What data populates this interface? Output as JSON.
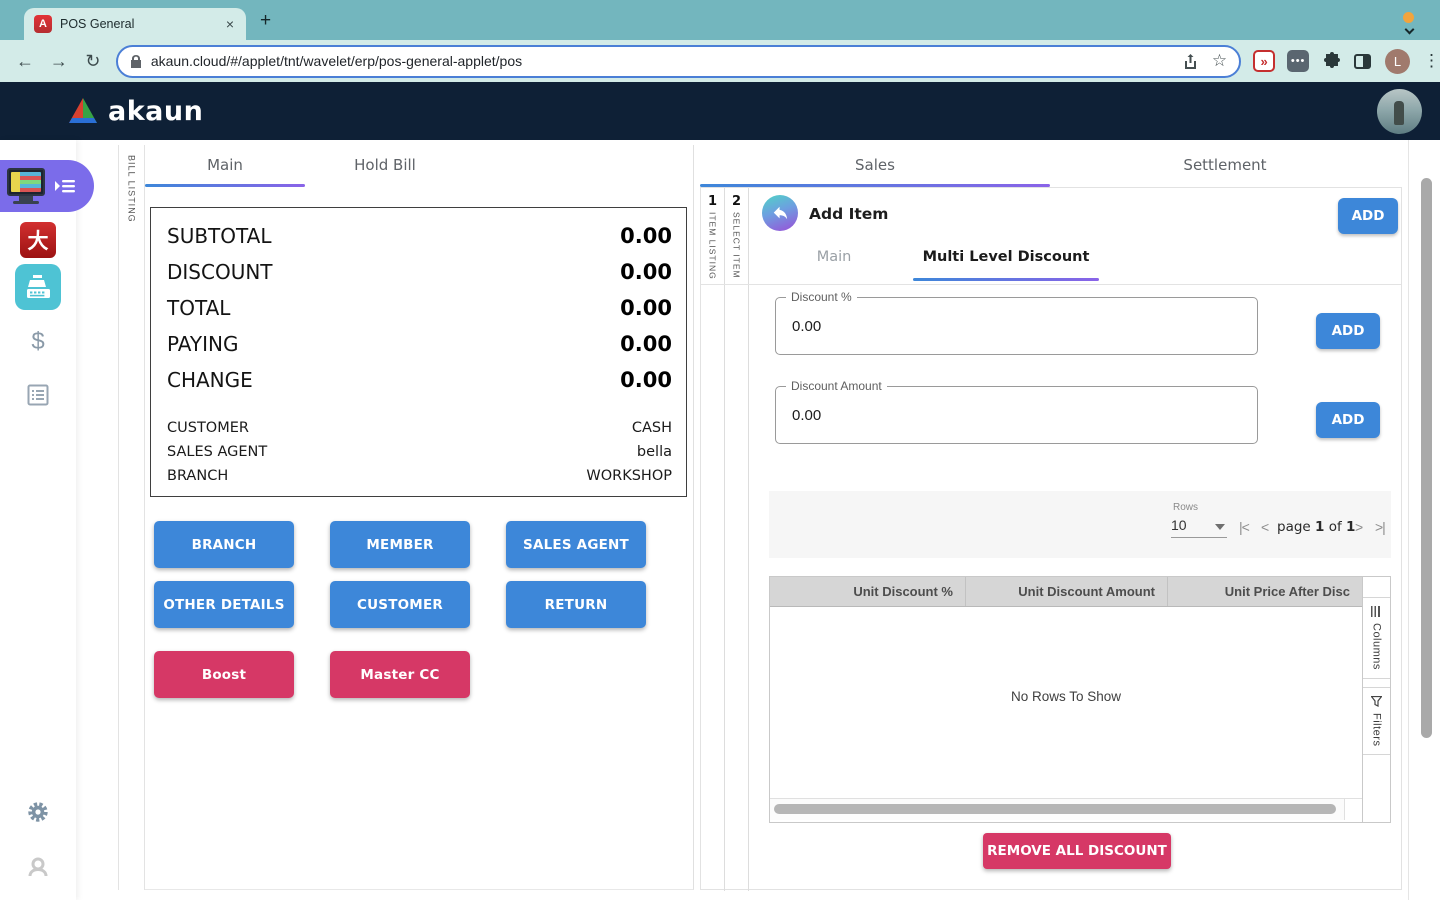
{
  "theme": {
    "navy": "#0e2036",
    "tabbar_teal": "#73b6be",
    "toolbar_mint": "#d3ebe8",
    "primary_blue": "#3d87d9",
    "accent_pink": "#d63866",
    "sidebar_purple": "#7b6cea",
    "sidebar_cyan": "#4ec3d4",
    "underline_gradient": [
      "#3d87d9",
      "#8a63e8"
    ]
  },
  "browser": {
    "tab_title": "POS General",
    "close_glyph": "×",
    "new_tab_glyph": "+",
    "back_glyph": "←",
    "forward_glyph": "→",
    "reload_glyph": "↻",
    "url": "akaun.cloud/#/applet/tnt/wavelet/erp/pos-general-applet/pos",
    "star_glyph": "☆",
    "ext_red_glyph": "»",
    "ext_dots_glyph": "•••",
    "profile_initial": "L",
    "menu_glyph": "⋮"
  },
  "navbar": {
    "brand": "akaun"
  },
  "sidebar": {
    "cny_char": "大",
    "dollar_glyph": "$"
  },
  "main_panel": {
    "rail_label": "BILL LISTING",
    "tabs": [
      {
        "label": "Main"
      },
      {
        "label": "Hold Bill"
      }
    ],
    "totals": [
      {
        "label": "SUBTOTAL",
        "value": "0.00"
      },
      {
        "label": "DISCOUNT",
        "value": "0.00"
      },
      {
        "label": "TOTAL",
        "value": "0.00"
      },
      {
        "label": "PAYING",
        "value": "0.00"
      },
      {
        "label": "CHANGE",
        "value": "0.00"
      }
    ],
    "info": [
      {
        "label": "CUSTOMER",
        "value": "CASH"
      },
      {
        "label": "SALES AGENT",
        "value": "bella"
      },
      {
        "label": "BRANCH",
        "value": "WORKSHOP"
      }
    ],
    "action_buttons": [
      "BRANCH",
      "MEMBER",
      "SALES AGENT",
      "OTHER DETAILS",
      "CUSTOMER",
      "RETURN"
    ],
    "special_buttons": [
      "Boost",
      "Master CC"
    ]
  },
  "right_panel": {
    "tabs": [
      {
        "label": "Sales"
      },
      {
        "label": "Settlement"
      }
    ],
    "rails": [
      {
        "num": "1",
        "label": "ITEM LISTING"
      },
      {
        "num": "2",
        "label": "SELECT ITEM"
      }
    ],
    "header": {
      "title": "Add Item",
      "add_label": "ADD"
    },
    "inner_tabs": [
      {
        "label": "Main"
      },
      {
        "label": "Multi Level Discount"
      }
    ],
    "fields": [
      {
        "label": "Discount %",
        "value": "0.00",
        "button": "ADD"
      },
      {
        "label": "Discount Amount",
        "value": "0.00",
        "button": "ADD"
      }
    ],
    "pagination": {
      "rows_label": "Rows",
      "rows_value": "10",
      "first": "|<",
      "prev": "<",
      "page_word": "page",
      "page_num": "1",
      "of_word": "of",
      "page_total": "1",
      "next": ">",
      "last": ">|"
    },
    "grid": {
      "columns": [
        "Unit Discount %",
        "Unit Discount Amount",
        "Unit Price After Disc"
      ],
      "empty_text": "No Rows To Show",
      "side_tabs": [
        "Columns",
        "Filters"
      ]
    },
    "remove_all_label": "REMOVE ALL DISCOUNT"
  }
}
